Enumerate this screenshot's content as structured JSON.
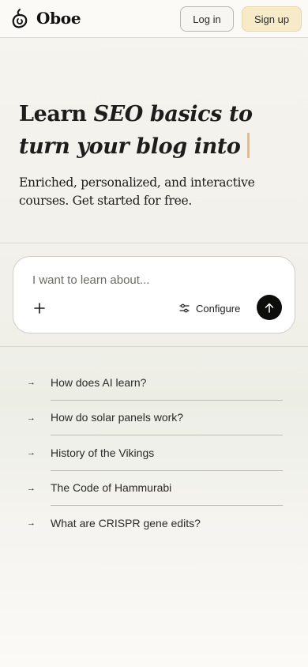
{
  "header": {
    "brand": "Oboe",
    "login_label": "Log in",
    "signup_label": "Sign up"
  },
  "hero": {
    "title_start": "Learn ",
    "title_italic": "SEO basics to turn your blog into",
    "subtitle": "Enriched, personalized, and interactive courses. Get started for free."
  },
  "prompt": {
    "placeholder": "I want to learn about...",
    "configure_label": "Configure"
  },
  "suggestions": [
    {
      "arrow": "→",
      "label": "How does AI learn?"
    },
    {
      "arrow": "→",
      "label": "How do solar panels work?"
    },
    {
      "arrow": "→",
      "label": "History of the Vikings"
    },
    {
      "arrow": "→",
      "label": "The Code of Hammurabi"
    },
    {
      "arrow": "→",
      "label": "What are CRISPR gene edits?"
    }
  ],
  "colors": {
    "signup_bg": "#f7ebc7",
    "caret": "#f1b87a",
    "send_button": "#0d0d0c"
  },
  "icons": {
    "logo": "oboe-logo-icon",
    "add": "plus-icon",
    "configure": "sliders-icon",
    "send": "arrow-up-icon",
    "suggestion": "arrow-right-icon"
  }
}
